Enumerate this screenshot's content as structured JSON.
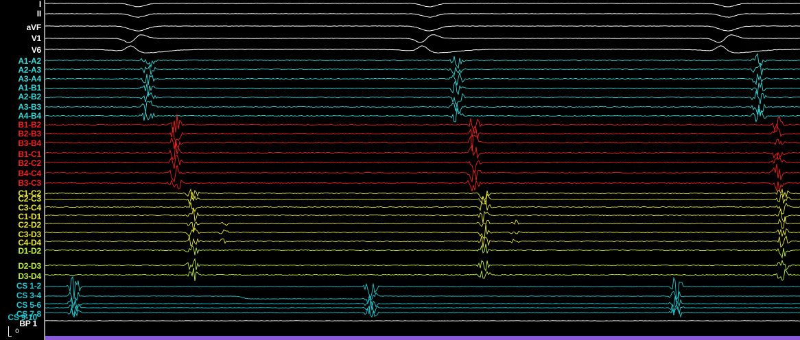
{
  "colors": {
    "surface": "#ffffff",
    "atrial": "#38d8d8",
    "his": "#ee2222",
    "ventricular": "#e6e63a",
    "distal": "#c2f046",
    "cs": "#22c8d0",
    "bp": "#ffffff",
    "time_bar": "#8a5ad8"
  },
  "channels": [
    {
      "label": "I",
      "group": "surface"
    },
    {
      "label": "II",
      "group": "surface"
    },
    {
      "label": "aVF",
      "group": "surface"
    },
    {
      "label": "V1",
      "group": "surface"
    },
    {
      "label": "V6",
      "group": "surface"
    },
    {
      "label": "A1-A2",
      "group": "atrial"
    },
    {
      "label": "A2-A3",
      "group": "atrial"
    },
    {
      "label": "A3-A4",
      "group": "atrial"
    },
    {
      "label": "A1-B1",
      "group": "atrial"
    },
    {
      "label": "A2-B2",
      "group": "atrial"
    },
    {
      "label": "A3-B3",
      "group": "atrial"
    },
    {
      "label": "A4-B4",
      "group": "atrial"
    },
    {
      "label": "B1-B2",
      "group": "his"
    },
    {
      "label": "B2-B3",
      "group": "his"
    },
    {
      "label": "B3-B4",
      "group": "his"
    },
    {
      "label": "B1-C1",
      "group": "his"
    },
    {
      "label": "B2-C2",
      "group": "his"
    },
    {
      "label": "B4-C4",
      "group": "his"
    },
    {
      "label": "B3-C3",
      "group": "his"
    },
    {
      "label": "C1-C2",
      "group": "ventricular"
    },
    {
      "label": "C2-C3",
      "group": "ventricular"
    },
    {
      "label": "C3-C4",
      "group": "ventricular"
    },
    {
      "label": "C1-D1",
      "group": "ventricular"
    },
    {
      "label": "C2-D2",
      "group": "ventricular"
    },
    {
      "label": "C3-D3",
      "group": "ventricular"
    },
    {
      "label": "C4-D4",
      "group": "ventricular"
    },
    {
      "label": "D1-D2",
      "group": "distal"
    },
    {
      "label": "D2-D3",
      "group": "distal"
    },
    {
      "label": "D3-D4",
      "group": "distal"
    },
    {
      "label": "CS 1-2",
      "group": "cs"
    },
    {
      "label": "CS 3-4",
      "group": "cs"
    },
    {
      "label": "CS 5-6",
      "group": "cs"
    },
    {
      "label": "CS 7-8",
      "group": "cs"
    },
    {
      "label": "CS 9-10",
      "group": "cs"
    },
    {
      "label": "BP 1",
      "group": "bp"
    }
  ],
  "scale_label": "0"
}
